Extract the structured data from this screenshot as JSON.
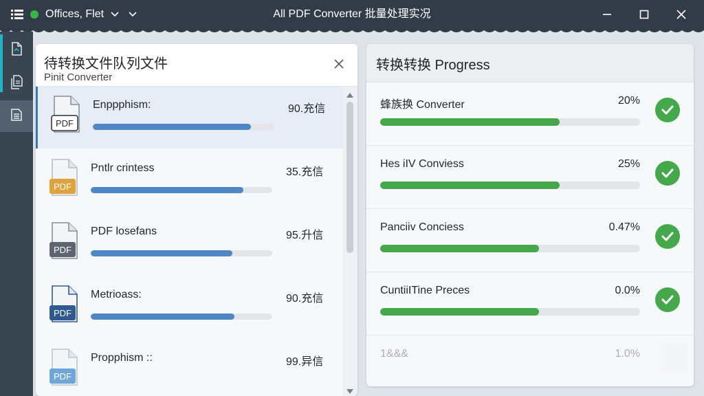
{
  "window": {
    "app_label": "Offices, Flet",
    "title": "All PDF Converter 批量处理实况",
    "controls": [
      "minimize",
      "maximize",
      "close"
    ]
  },
  "sidebar": {
    "items": [
      {
        "icon": "pdf-convert-icon",
        "active": false
      },
      {
        "icon": "documents-icon",
        "active": false
      },
      {
        "icon": "document-list-icon",
        "active": true
      }
    ]
  },
  "left_panel": {
    "title": "待转换文件队列文件",
    "subtitle": "Pinit Converter",
    "files": [
      {
        "name": "Enppphism:",
        "size": "90.充信",
        "progress": 0.87,
        "icon_color": "#ffffff",
        "selected": true
      },
      {
        "name": "Pntlr crintess",
        "size": "35.充信",
        "progress": 0.84,
        "icon_color": "#e0a23c",
        "selected": false
      },
      {
        "name": "PDF losefans",
        "size": "95.升信",
        "progress": 0.78,
        "icon_color": "#5d6670",
        "selected": false
      },
      {
        "name": "Metrioass:",
        "size": "90.充信",
        "progress": 0.79,
        "icon_color": "#2e5a8e",
        "selected": false
      },
      {
        "name": "Propphism ::",
        "size": "99.异信",
        "progress": null,
        "icon_color": "#6fa8d8",
        "selected": false
      }
    ]
  },
  "right_panel": {
    "title": "转换转换 Progress",
    "conversions": [
      {
        "name": "蜂族换 Converter",
        "percent_text": "20%",
        "progress": 0.69,
        "done": true
      },
      {
        "name": "Hes iIV Conviess",
        "percent_text": "25%",
        "progress": 0.69,
        "done": true
      },
      {
        "name": "Panciiv Conciess",
        "percent_text": "0.47%",
        "progress": 0.61,
        "done": true
      },
      {
        "name": "CuntiiITine Preces",
        "percent_text": "0.0%",
        "progress": 0.61,
        "done": true
      },
      {
        "name": "1&&&",
        "percent_text": "1.0%",
        "progress": null,
        "done": false
      }
    ]
  },
  "colors": {
    "titlebar": "#323c48",
    "accent_blue": "#4f86c6",
    "accent_green": "#45a84b",
    "rail_accent": "#22b3c8"
  }
}
